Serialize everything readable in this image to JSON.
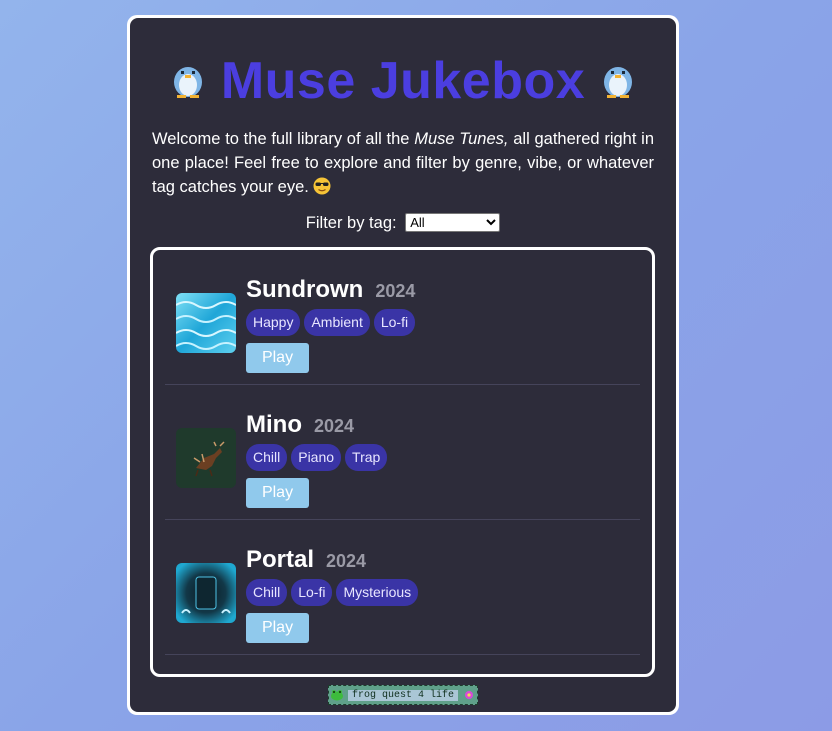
{
  "header": {
    "title": "Muse Jukebox"
  },
  "intro": {
    "before": "Welcome to the full library of all the ",
    "emph": "Muse Tunes,",
    "after": " all gathered right in one place! Feel free to explore and filter by genre, vibe, or whatever tag catches your eye. "
  },
  "filter": {
    "label": "Filter by tag:",
    "selected": "All"
  },
  "songs": [
    {
      "name": "Sundrown",
      "year": "2024",
      "tags": [
        "Happy",
        "Ambient",
        "Lo-fi"
      ],
      "play_label": "Play"
    },
    {
      "name": "Mino",
      "year": "2024",
      "tags": [
        "Chill",
        "Piano",
        "Trap"
      ],
      "play_label": "Play"
    },
    {
      "name": "Portal",
      "year": "2024",
      "tags": [
        "Chill",
        "Lo-fi",
        "Mysterious"
      ],
      "play_label": "Play"
    }
  ],
  "badge": {
    "text": "frog quest 4 life"
  },
  "colors": {
    "title": "#4b3ee0",
    "tag_bg": "#3a34a6",
    "play_bg": "#90c9ec",
    "panel_bg": "#2d2c3a"
  }
}
